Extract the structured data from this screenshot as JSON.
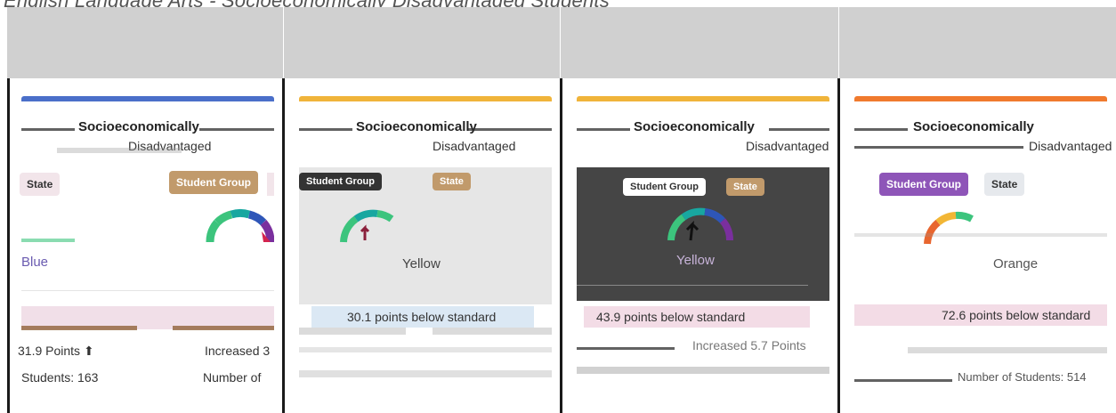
{
  "page_title": "English Language Arts - Socioeconomically Disadvantaged Students",
  "panels": [
    {
      "heading": "Socioeconomically",
      "subheading": "Disadvantaged",
      "tags": [
        "State",
        "Student Group"
      ],
      "color_label": "Blue",
      "points": "31.9 Points",
      "change": "Increased 3",
      "students": "Students: 163",
      "number_of": "Number of",
      "accent": "#4a6fc9"
    },
    {
      "heading": "Socioeconomically",
      "subheading": "Disadvantaged",
      "tags": [
        "Student Group",
        "State"
      ],
      "color_label": "Yellow",
      "status": "30.1 points below standard",
      "accent": "#f0b43a"
    },
    {
      "heading": "Socioeconomically",
      "subheading": "Disadvantaged",
      "tags": [
        "Student Group",
        "State"
      ],
      "color_label": "Yellow",
      "status": "43.9 points below standard",
      "change": "Increased 5.7 Points",
      "accent": "#f0b43a"
    },
    {
      "heading": "Socioeconomically",
      "subheading": "Disadvantaged",
      "tags": [
        "Student Group",
        "State"
      ],
      "color_label": "Orange",
      "status": "72.6 points below standard",
      "students": "Number of Students: 514",
      "accent": "#f07a2e"
    }
  ],
  "gauge_colors": [
    "#e8662f",
    "#f2b635",
    "#3cc47d",
    "#18a7a0",
    "#2e56b8",
    "#7a2f9e",
    "#d4244e"
  ]
}
